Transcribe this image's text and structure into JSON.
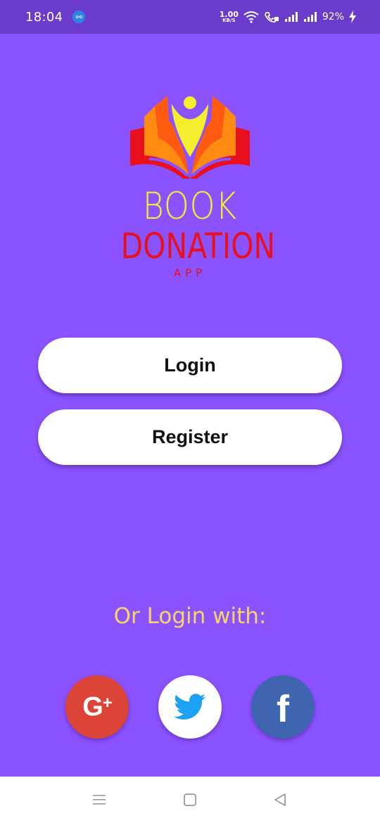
{
  "status_bar": {
    "time": "18:04",
    "usb_icon": "usb-icon",
    "net_speed_value": "1.00",
    "net_speed_unit": "KB/S",
    "battery": "92%"
  },
  "logo": {
    "line1": "BOOK",
    "line2": "DONATION",
    "line3": "APP"
  },
  "buttons": {
    "login": "Login",
    "register": "Register"
  },
  "social": {
    "prompt": "Or Login with:",
    "google_label": "G",
    "google_plus": "+",
    "facebook_label": "f"
  },
  "colors": {
    "background": "#8b52ff",
    "status_bar": "#6a3cc9",
    "google": "#dc4437",
    "facebook": "#3f65b0",
    "twitter": "#1da1f2",
    "prompt_text": "#f6d564"
  }
}
